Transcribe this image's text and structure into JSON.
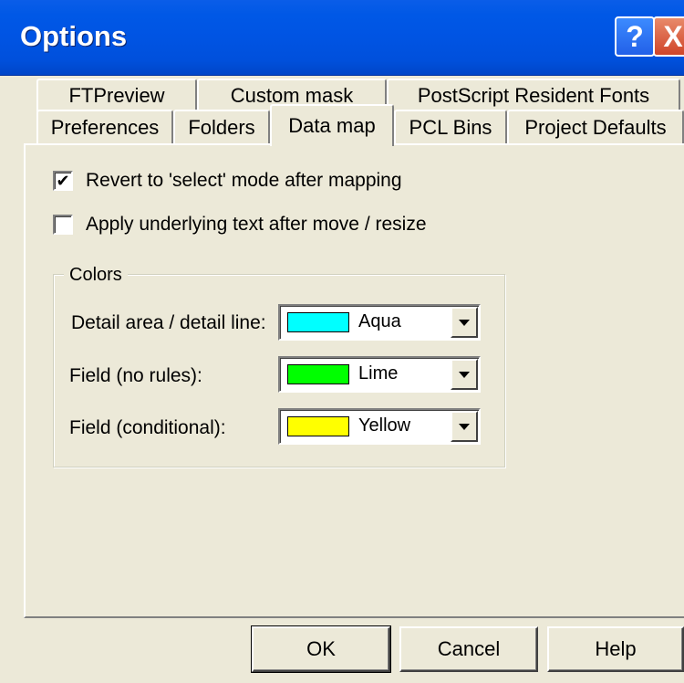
{
  "window": {
    "title": "Options",
    "help_button": "?",
    "close_button": "X"
  },
  "tabs": {
    "back_row": [
      "FTPreview",
      "Custom mask",
      "PostScript Resident Fonts"
    ],
    "front_row": [
      "Preferences",
      "Folders",
      "Data map",
      "PCL Bins",
      "Project Defaults"
    ],
    "active": "Data map"
  },
  "options": {
    "revert_select": {
      "label": "Revert to 'select' mode after mapping",
      "checked": true
    },
    "apply_underlying": {
      "label": "Apply underlying text after move / resize",
      "checked": false
    }
  },
  "colors": {
    "group_label": "Colors",
    "rows": [
      {
        "label": "Detail area / detail line:",
        "value": "Aqua",
        "swatch": "#00ffff"
      },
      {
        "label": "Field (no rules):",
        "value": "Lime",
        "swatch": "#00ff00"
      },
      {
        "label": "Field (conditional):",
        "value": "Yellow",
        "swatch": "#ffff00"
      }
    ]
  },
  "buttons": {
    "ok": "OK",
    "cancel": "Cancel",
    "help": "Help"
  },
  "checkmark_glyph": "✔"
}
